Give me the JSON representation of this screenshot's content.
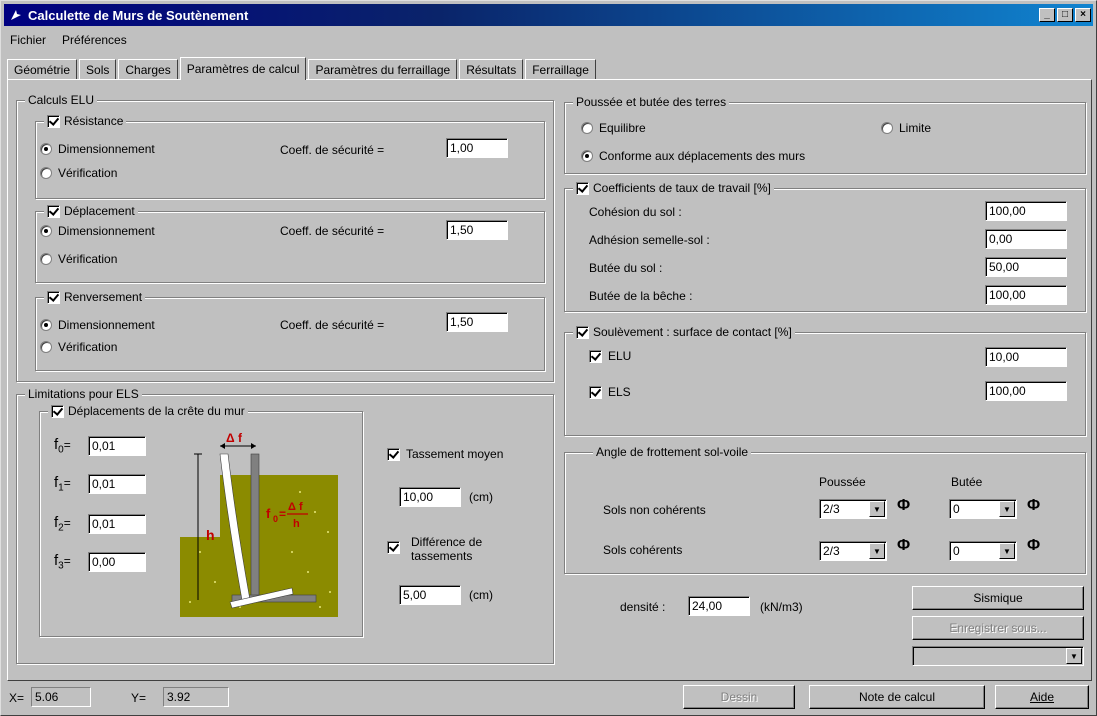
{
  "window": {
    "title": "Calculette de Murs de Soutènement"
  },
  "menu": {
    "file": "Fichier",
    "prefs": "Préférences"
  },
  "tabs": [
    "Géométrie",
    "Sols",
    "Charges",
    "Paramètres de calcul",
    "Paramètres du ferraillage",
    "Résultats",
    "Ferraillage"
  ],
  "elu": {
    "title": "Calculs ELU",
    "coef_label": "Coeff. de sécurité =",
    "dim": "Dimensionnement",
    "verif": "Vérification",
    "resistance": {
      "label": "Résistance",
      "checked": true,
      "coef": "1,00"
    },
    "deplacement": {
      "label": "Déplacement",
      "checked": true,
      "coef": "1,50"
    },
    "renversement": {
      "label": "Renversement",
      "checked": true,
      "coef": "1,50"
    }
  },
  "els": {
    "title": "Limitations pour ELS",
    "crete_label": "Déplacements de la crête du mur",
    "f0": "0,01",
    "f1": "0,01",
    "f2": "0,01",
    "f3": "0,00",
    "diagram": {
      "delta": "Δ f",
      "h": "h",
      "formula_f": "f",
      "formula_sub": "0",
      "formula_num": "Δ f",
      "formula_den": "h"
    },
    "tassement_label": "Tassement moyen",
    "tassement_value": "10,00",
    "unit_cm": "(cm)",
    "difference_label_1": "Différence de",
    "difference_label_2": "tassements",
    "difference_value": "5,00"
  },
  "poussee": {
    "title": "Poussée et butée des terres",
    "equilibre": "Equilibre",
    "limite": "Limite",
    "conforme": "Conforme aux déplacements des murs"
  },
  "coef_taux": {
    "title": "Coefficients de taux de travail [%]",
    "rows": [
      {
        "label": "Cohésion du sol :",
        "value": "100,00"
      },
      {
        "label": "Adhésion semelle-sol :",
        "value": "0,00"
      },
      {
        "label": "Butée du sol :",
        "value": "50,00"
      },
      {
        "label": "Butée de la bêche :",
        "value": "100,00"
      }
    ]
  },
  "soulevement": {
    "title": "Soulèvement : surface de contact [%]",
    "elu_label": "ELU",
    "elu_value": "10,00",
    "els_label": "ELS",
    "els_value": "100,00"
  },
  "angle": {
    "title": "Angle de frottement sol-voile",
    "col_poussee": "Poussée",
    "col_butee": "Butée",
    "phi": "Φ",
    "row1": {
      "label": "Sols non cohérents",
      "poussee": "2/3",
      "butee": "0"
    },
    "row2": {
      "label": "Sols cohérents",
      "poussee": "2/3",
      "butee": "0"
    }
  },
  "densite": {
    "label": "densité :",
    "value": "24,00",
    "unit": "(kN/m3)"
  },
  "buttons": {
    "sismique": "Sismique",
    "enregistrer": "Enregistrer sous...",
    "dessin": "Dessin",
    "note": "Note de calcul",
    "aide": "Aide"
  },
  "status": {
    "x_label": "X=",
    "x_value": "5.06",
    "y_label": "Y=",
    "y_value": "3.92"
  },
  "colors": {
    "title_bar": "#000080",
    "soil": "#8b8b00",
    "wall": "#808080",
    "formula": "#c00000"
  }
}
